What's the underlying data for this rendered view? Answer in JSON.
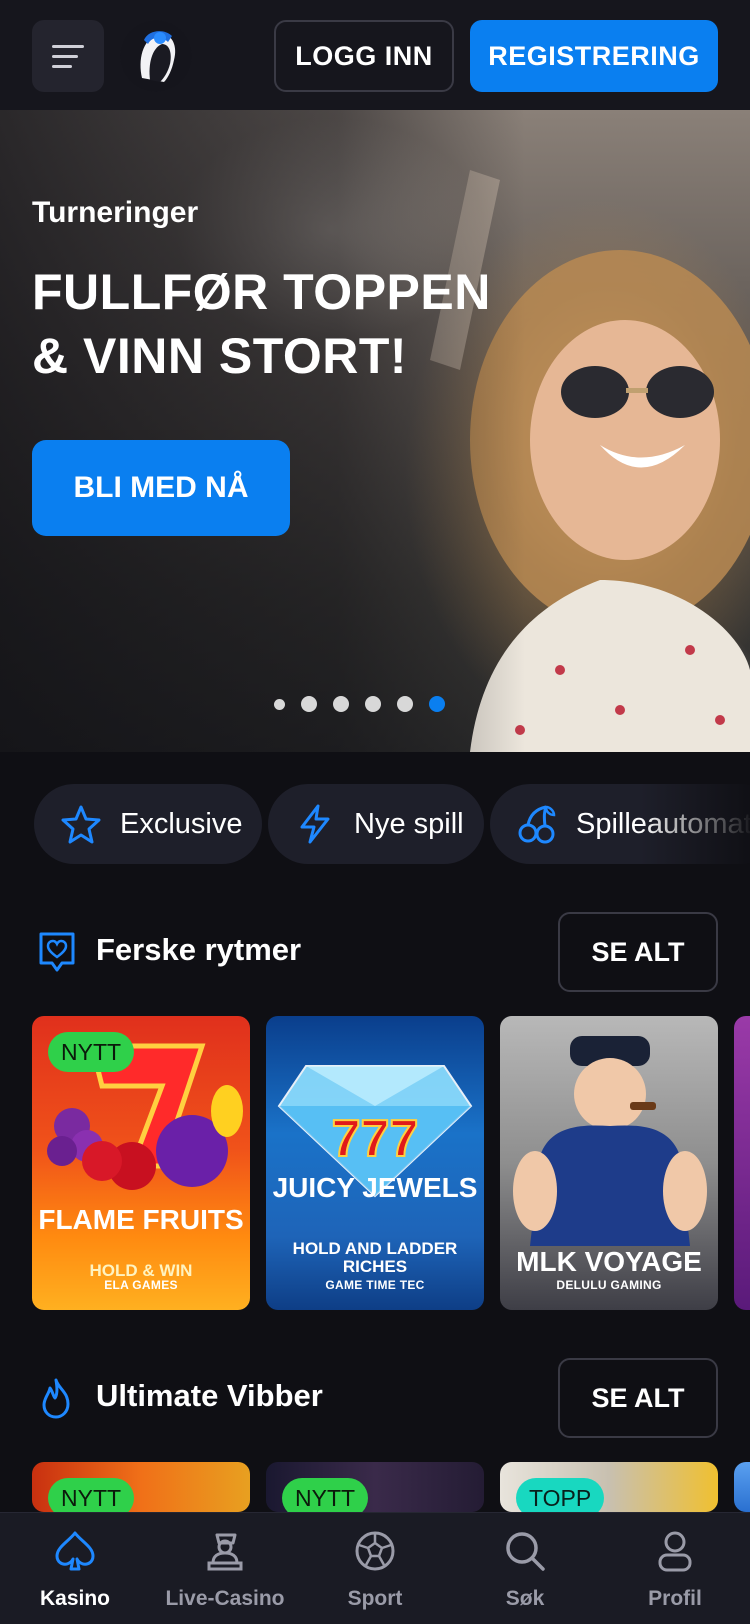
{
  "header": {
    "login_label": "LOGG INN",
    "register_label": "REGISTRERING"
  },
  "hero": {
    "subtitle": "Turneringer",
    "title": "FULLFØR TOPPEN & VINN STORT!",
    "cta_label": "BLI MED NÅ",
    "slide_count": 6,
    "active_slide": 6
  },
  "categories": [
    {
      "label": "Exclusive",
      "icon": "star-icon"
    },
    {
      "label": "Nye spill",
      "icon": "lightning-icon"
    },
    {
      "label": "Spilleautomat",
      "icon": "cherries-icon"
    }
  ],
  "sections": [
    {
      "title": "Ferske rytmer",
      "icon": "heart-chat-icon",
      "see_all_label": "SE ALT",
      "games": [
        {
          "badge": "NYTT",
          "name": "FLAME FRUITS",
          "sub": "HOLD & WIN",
          "provider": "ELA GAMES"
        },
        {
          "badge": "",
          "name": "JUICY JEWELS",
          "sub": "HOLD AND LADDER RICHES",
          "provider": "GAME TIME TEC"
        },
        {
          "badge": "",
          "name": "MLK VOYAGE",
          "sub": "",
          "provider": "DELULU GAMING"
        }
      ]
    },
    {
      "title": "Ultimate Vibber",
      "icon": "flame-icon",
      "see_all_label": "SE ALT",
      "games": [
        {
          "badge": "NYTT"
        },
        {
          "badge": "NYTT"
        },
        {
          "badge": "TOPP"
        }
      ]
    }
  ],
  "bottom_nav": [
    {
      "label": "Kasino",
      "icon": "spade-icon",
      "active": true
    },
    {
      "label": "Live-Casino",
      "icon": "dealer-icon",
      "active": false
    },
    {
      "label": "Sport",
      "icon": "football-icon",
      "active": false
    },
    {
      "label": "Søk",
      "icon": "search-icon",
      "active": false
    },
    {
      "label": "Profil",
      "icon": "user-icon",
      "active": false
    }
  ],
  "colors": {
    "accent": "#0a7ff0",
    "background": "#0f0f14",
    "badge_new": "#2fd04a",
    "badge_top": "#18d8c0"
  }
}
